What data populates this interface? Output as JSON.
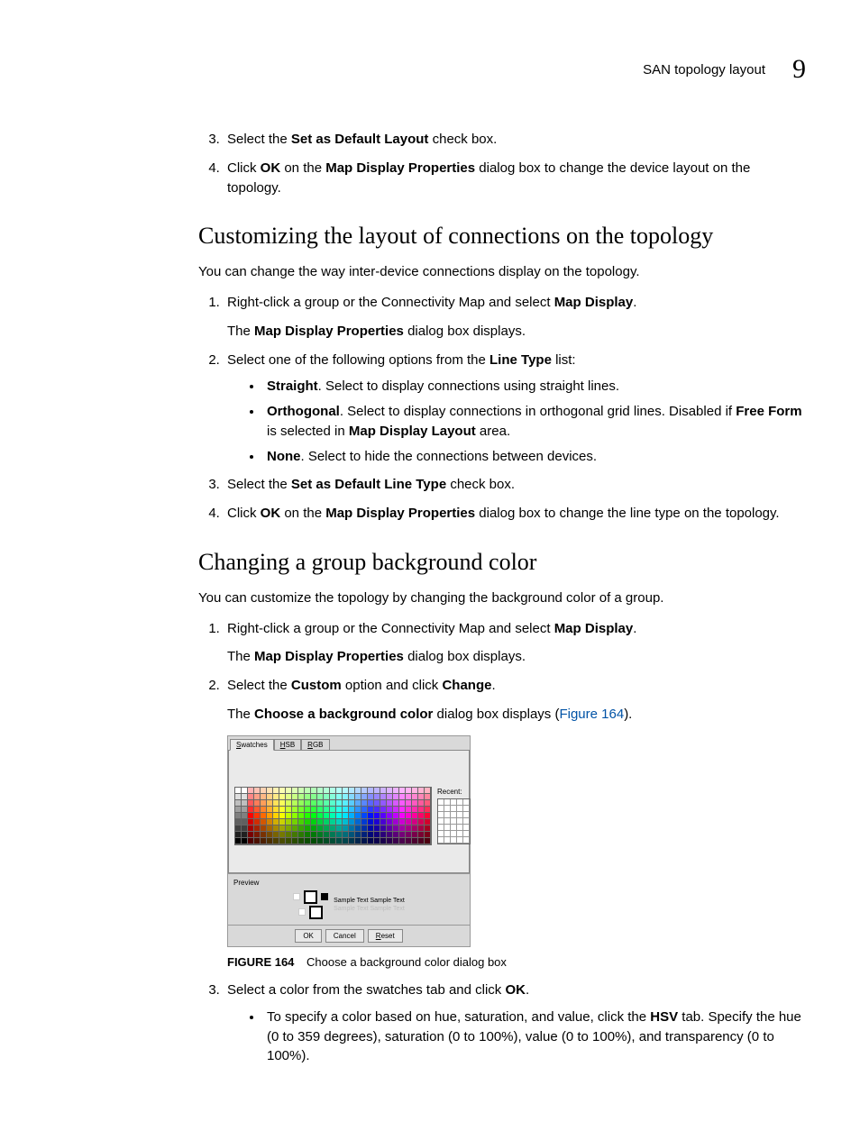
{
  "header": {
    "title": "SAN topology layout",
    "chapter": "9"
  },
  "intro_steps": [
    {
      "n": "3",
      "parts": [
        {
          "t": "Select the "
        },
        {
          "t": "Set as Default Layout",
          "b": true
        },
        {
          "t": " check box."
        }
      ]
    },
    {
      "n": "4",
      "parts": [
        {
          "t": "Click "
        },
        {
          "t": "OK",
          "b": true
        },
        {
          "t": " on the "
        },
        {
          "t": "Map Display Properties",
          "b": true
        },
        {
          "t": " dialog box to change the device layout on the topology."
        }
      ]
    }
  ],
  "section1": {
    "heading": "Customizing the layout of connections on the topology",
    "intro": "You can change the way inter-device connections display on the topology.",
    "steps": {
      "s1": {
        "parts": [
          {
            "t": "Right-click a group or the Connectivity Map and select "
          },
          {
            "t": "Map Display",
            "b": true
          },
          {
            "t": "."
          }
        ],
        "sub": [
          {
            "t": "The "
          },
          {
            "t": "Map Display Properties",
            "b": true
          },
          {
            "t": " dialog box displays."
          }
        ]
      },
      "s2": {
        "parts": [
          {
            "t": "Select one of the following options from the "
          },
          {
            "t": "Line Type",
            "b": true
          },
          {
            "t": " list:"
          }
        ],
        "bullets": [
          [
            {
              "t": "Straight",
              "b": true
            },
            {
              "t": ". Select to display connections using straight lines."
            }
          ],
          [
            {
              "t": "Orthogonal",
              "b": true
            },
            {
              "t": ". Select to display connections in orthogonal grid lines. Disabled if "
            },
            {
              "t": "Free Form",
              "b": true
            },
            {
              "t": " is selected in "
            },
            {
              "t": "Map Display Layout",
              "b": true
            },
            {
              "t": " area."
            }
          ],
          [
            {
              "t": "None",
              "b": true
            },
            {
              "t": ". Select to hide the connections between devices."
            }
          ]
        ]
      },
      "s3": {
        "parts": [
          {
            "t": "Select the "
          },
          {
            "t": "Set as Default Line Type",
            "b": true
          },
          {
            "t": " check box."
          }
        ]
      },
      "s4": {
        "parts": [
          {
            "t": "Click "
          },
          {
            "t": "OK",
            "b": true
          },
          {
            "t": " on the "
          },
          {
            "t": "Map Display Properties",
            "b": true
          },
          {
            "t": " dialog box to change the line type on the topology."
          }
        ]
      }
    }
  },
  "section2": {
    "heading": "Changing a group background color",
    "intro": "You can customize the topology by changing the background color of a group.",
    "steps": {
      "s1": {
        "parts": [
          {
            "t": "Right-click a group or the Connectivity Map and select "
          },
          {
            "t": "Map Display",
            "b": true
          },
          {
            "t": "."
          }
        ],
        "sub": [
          {
            "t": "The "
          },
          {
            "t": "Map Display Properties",
            "b": true
          },
          {
            "t": " dialog box displays."
          }
        ]
      },
      "s2": {
        "parts": [
          {
            "t": "Select the "
          },
          {
            "t": "Custom",
            "b": true
          },
          {
            "t": " option and click "
          },
          {
            "t": "Change",
            "b": true
          },
          {
            "t": "."
          }
        ],
        "sub": [
          {
            "t": "The "
          },
          {
            "t": "Choose a background color",
            "b": true
          },
          {
            "t": " dialog box displays ("
          },
          {
            "t": "Figure 164",
            "link": true
          },
          {
            "t": ")."
          }
        ]
      },
      "s3": {
        "parts": [
          {
            "t": "Select a color from the swatches tab and click "
          },
          {
            "t": "OK",
            "b": true
          },
          {
            "t": "."
          }
        ],
        "bullets": [
          [
            {
              "t": "To specify a color based on hue, saturation, and value, click the "
            },
            {
              "t": "HSV",
              "b": true
            },
            {
              "t": " tab. Specify the hue (0 to 359 degrees), saturation (0 to 100%), value (0 to 100%), and transparency (0 to 100%)."
            }
          ]
        ]
      }
    }
  },
  "dialog": {
    "tabs": {
      "swatches": "Swatches",
      "hsb": "HSB",
      "rgb": "RGB"
    },
    "recent_label": "Recent:",
    "preview_label": "Preview",
    "sample_text": "Sample Text Sample Text",
    "buttons": {
      "ok": "OK",
      "cancel": "Cancel",
      "reset": "Reset"
    }
  },
  "figure_caption": {
    "label": "FIGURE 164",
    "text": "Choose a background color dialog box"
  }
}
